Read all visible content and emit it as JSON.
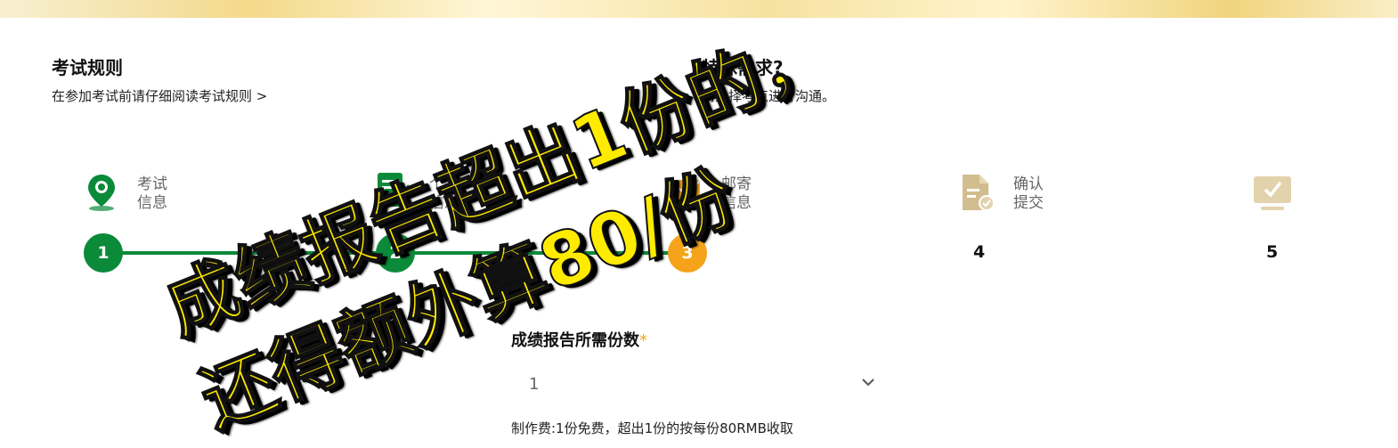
{
  "rules": {
    "title": "考试规则",
    "desc": "在参加考试前请仔细阅读考试规则 >"
  },
  "special": {
    "title": "特殊需求?",
    "desc": "请选择考点进行沟通。"
  },
  "steps": [
    {
      "number": "1",
      "label_line1": "考试",
      "label_line2": "信息",
      "icon": "location-pin-icon",
      "state": "done"
    },
    {
      "number": "2",
      "label_line1": "个人",
      "label_line2": "信息",
      "icon": "form-edit-icon",
      "state": "done"
    },
    {
      "number": "3",
      "label_line1": "邮寄",
      "label_line2": "信息",
      "icon": "mail-icon",
      "state": "active"
    },
    {
      "number": "4",
      "label_line1": "确认",
      "label_line2": "提交",
      "icon": "document-check-icon",
      "state": "pending"
    },
    {
      "number": "5",
      "label_line1": "",
      "label_line2": "",
      "icon": "monitor-check-icon",
      "state": "pending"
    }
  ],
  "form": {
    "copies_label": "成绩报告所需份数",
    "required_mark": "*",
    "copies_value": "1",
    "fee_note": "制作费:1份免费，超出1份的按每份80RMB收取"
  },
  "overlay": {
    "line1": "成绩报告超出1份的，",
    "line2": "还得额外算80/份"
  },
  "colors": {
    "done_green": "#0b8a3a",
    "active_orange": "#f5a31a",
    "pending_tan": "#c9b07a",
    "overlay_yellow": "#ffeb00"
  }
}
